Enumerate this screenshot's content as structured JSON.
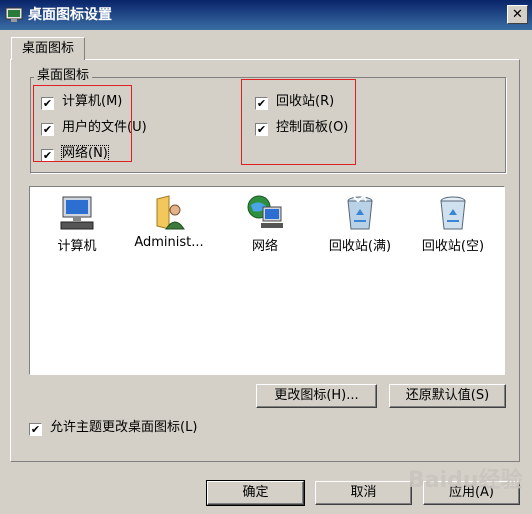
{
  "window": {
    "title": "桌面图标设置",
    "close_label": "✕"
  },
  "tabs": [
    {
      "label": "桌面图标"
    }
  ],
  "group": {
    "legend": "桌面图标",
    "checkboxes": [
      {
        "label": "计算机(M)",
        "checked": "✔"
      },
      {
        "label": "用户的文件(U)",
        "checked": "✔"
      },
      {
        "label": "网络(N)",
        "checked": "✔"
      },
      {
        "label": "回收站(R)",
        "checked": "✔"
      },
      {
        "label": "控制面板(O)",
        "checked": "✔"
      }
    ]
  },
  "icons": [
    {
      "label": "计算机",
      "icon": "computer-icon"
    },
    {
      "label": "Administ...",
      "icon": "user-folder-icon"
    },
    {
      "label": "网络",
      "icon": "network-icon"
    },
    {
      "label": "回收站(满)",
      "icon": "recycle-bin-full-icon"
    },
    {
      "label": "回收站(空)",
      "icon": "recycle-bin-empty-icon"
    }
  ],
  "buttons": {
    "change_icon": "更改图标(H)...",
    "restore_default": "还原默认值(S)",
    "ok": "确定",
    "cancel": "取消",
    "apply": "应用(A)"
  },
  "allow_theme": {
    "label": "允许主题更改桌面图标(L)",
    "checked": "✔"
  },
  "highlight_color": "#e02020",
  "watermark": "Baidu经验"
}
